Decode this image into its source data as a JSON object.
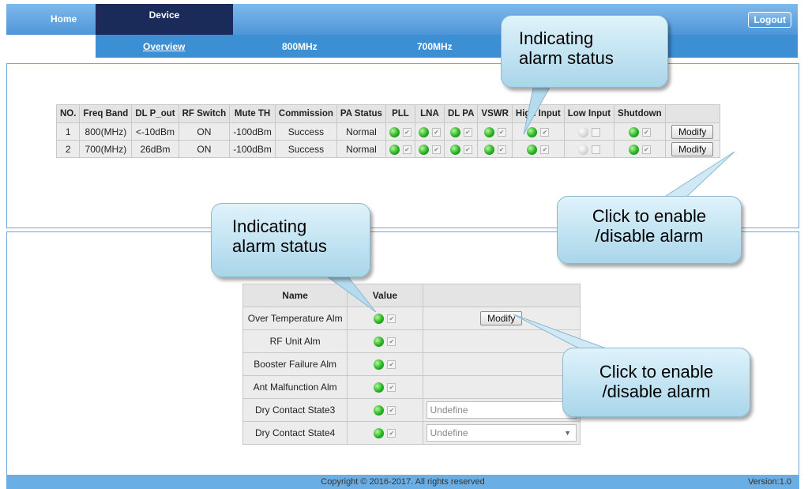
{
  "nav": {
    "home": "Home",
    "device": "Device",
    "logout": "Logout"
  },
  "subtabs": {
    "overview": "Overview",
    "band800": "800MHz",
    "band700": "700MHz"
  },
  "status_table": {
    "headers": [
      "NO.",
      "Freq Band",
      "DL P_out",
      "RF Switch",
      "Mute TH",
      "Commission",
      "PA Status",
      "PLL",
      "LNA",
      "DL PA",
      "VSWR",
      "High Input",
      "Low Input",
      "Shutdown",
      ""
    ],
    "rows": [
      {
        "no": "1",
        "freq": "800(MHz)",
        "pout": "<-10dBm",
        "rf": "ON",
        "mute": "-100dBm",
        "commission": "Success",
        "pa": "Normal",
        "modify": "Modify"
      },
      {
        "no": "2",
        "freq": "700(MHz)",
        "pout": "26dBm",
        "rf": "ON",
        "mute": "-100dBm",
        "commission": "Success",
        "pa": "Normal",
        "modify": "Modify"
      }
    ],
    "alarm_states": {
      "led_on_columns": [
        "PLL",
        "LNA",
        "DL PA",
        "VSWR",
        "High Input",
        "Shutdown"
      ],
      "led_off_columns": [
        "Low Input"
      ]
    }
  },
  "alarm_table": {
    "headers": {
      "name": "Name",
      "value": "Value"
    },
    "rows": [
      {
        "name": "Over Temperature Alm"
      },
      {
        "name": "RF Unit Alm"
      },
      {
        "name": "Booster Failure Alm"
      },
      {
        "name": "Ant Malfunction Alm"
      },
      {
        "name": "Dry Contact State3",
        "select": "Undefine"
      },
      {
        "name": "Dry Contact State4",
        "select": "Undefine"
      }
    ],
    "modify": "Modify"
  },
  "callouts": {
    "top_status": [
      "Indicating",
      "alarm status"
    ],
    "top_click": [
      "Click to enable",
      "/disable alarm"
    ],
    "bottom_status": [
      "Indicating",
      "alarm status"
    ],
    "bottom_click": [
      "Click to enable",
      "/disable alarm"
    ]
  },
  "footer": {
    "copyright": "Copyright © 2016-2017. All rights reserved",
    "version": "Version:1.0"
  },
  "colors": {
    "topbar": "#4f96d8",
    "device_tab": "#1b2b59",
    "subbar": "#3c8fd3",
    "led_on": "#27b322",
    "callout": "#a9d6ea"
  }
}
